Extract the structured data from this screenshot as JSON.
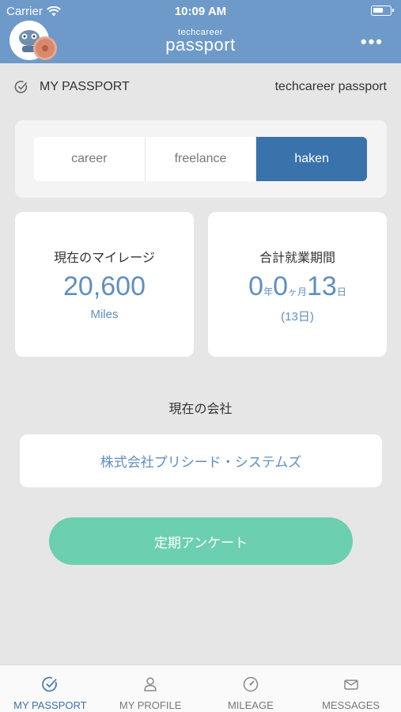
{
  "status_bar": {
    "carrier": "Carrier",
    "time": "10:09 AM"
  },
  "header": {
    "brand_small": "techcareer",
    "brand_big": "passport",
    "more_label": "•••"
  },
  "section": {
    "title": "MY PASSPORT",
    "subtitle": "techcareer passport"
  },
  "segments": [
    {
      "label": "career",
      "active": false
    },
    {
      "label": "freelance",
      "active": false
    },
    {
      "label": "haken",
      "active": true
    }
  ],
  "mileage": {
    "label": "現在のマイレージ",
    "value": "20,600",
    "unit": "Miles"
  },
  "period": {
    "label": "合計就業期間",
    "years": "0",
    "years_unit": "年",
    "months": "0",
    "months_unit": "ヶ月",
    "days": "13",
    "days_unit": "日",
    "total": "(13日)"
  },
  "company": {
    "label": "現在の会社",
    "name": "株式会社プリシード・システムズ"
  },
  "survey_button": "定期アンケート",
  "tabs": [
    {
      "label": "MY PASSPORT",
      "icon": "check-circle-icon",
      "active": true
    },
    {
      "label": "MY PROFILE",
      "icon": "person-icon",
      "active": false
    },
    {
      "label": "MILEAGE",
      "icon": "gauge-icon",
      "active": false
    },
    {
      "label": "MESSAGES",
      "icon": "envelope-icon",
      "active": false
    }
  ],
  "colors": {
    "header": "#6e9ac9",
    "accent": "#3a72ac",
    "value_blue": "#5f8fc0",
    "survey_green": "#6bcfb0",
    "background": "#e6e6e6"
  }
}
